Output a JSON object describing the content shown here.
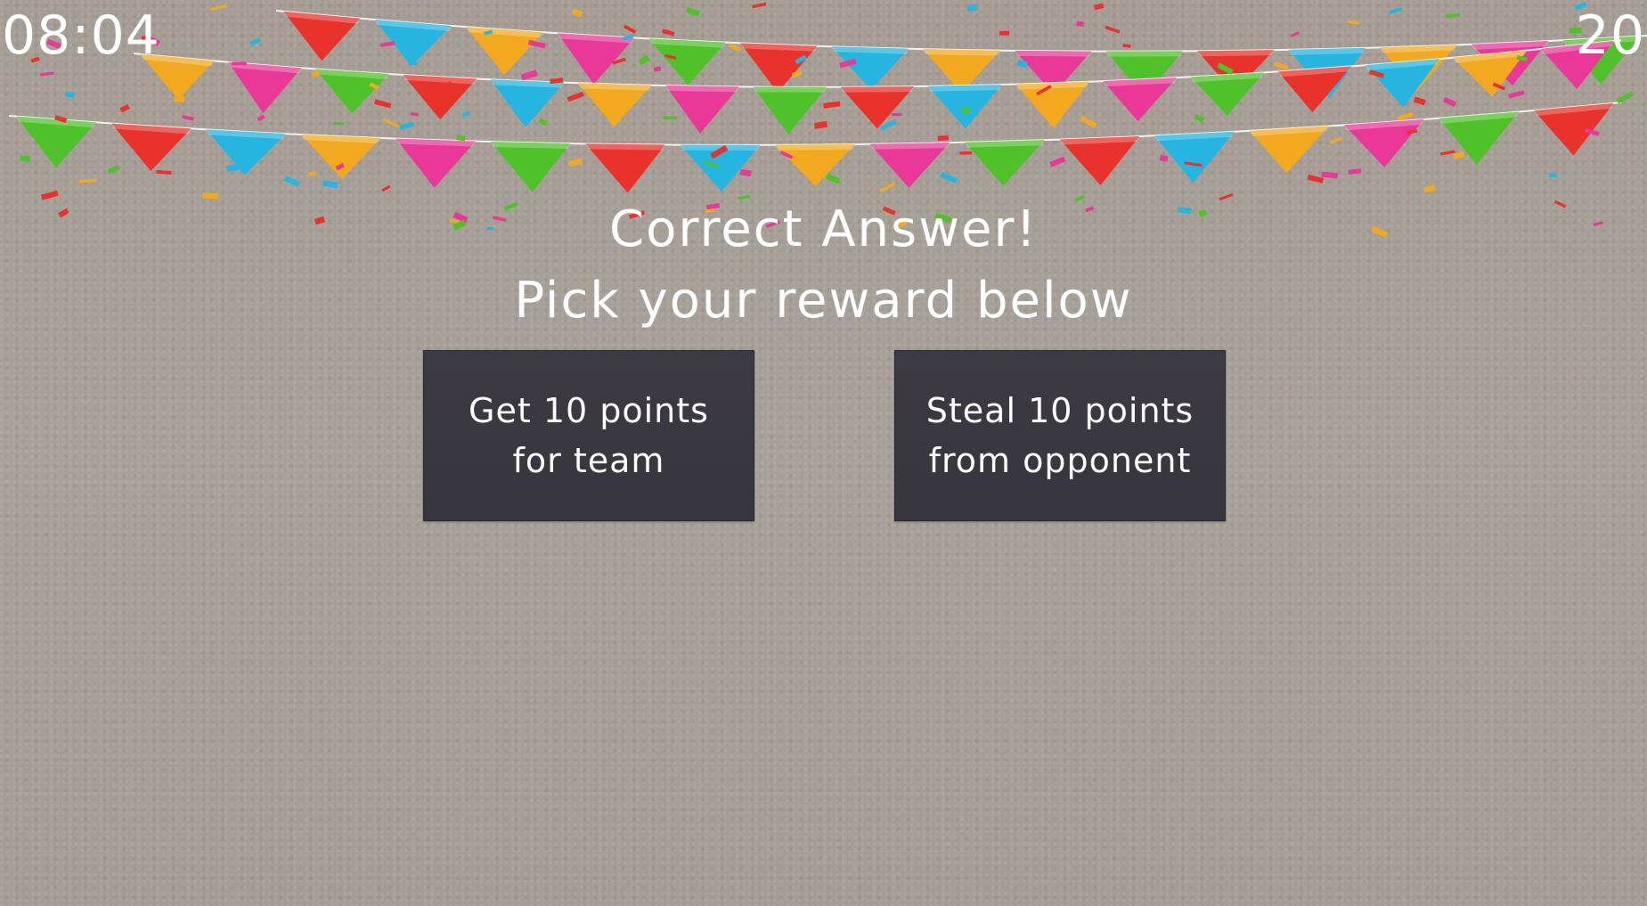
{
  "hud": {
    "timer": "08:04",
    "score": "20"
  },
  "heading": {
    "line1": "Correct Answer!",
    "line2": "Pick your reward below"
  },
  "rewards": [
    {
      "line1": "Get 10 points",
      "line2": "for team"
    },
    {
      "line1": "Steal 10 points",
      "line2": "from opponent"
    }
  ],
  "decoration": {
    "type": "party-bunting-with-confetti",
    "flag_colors": [
      "#e8322b",
      "#25b5e0",
      "#f2a91f",
      "#e93897",
      "#4fc22a"
    ]
  }
}
